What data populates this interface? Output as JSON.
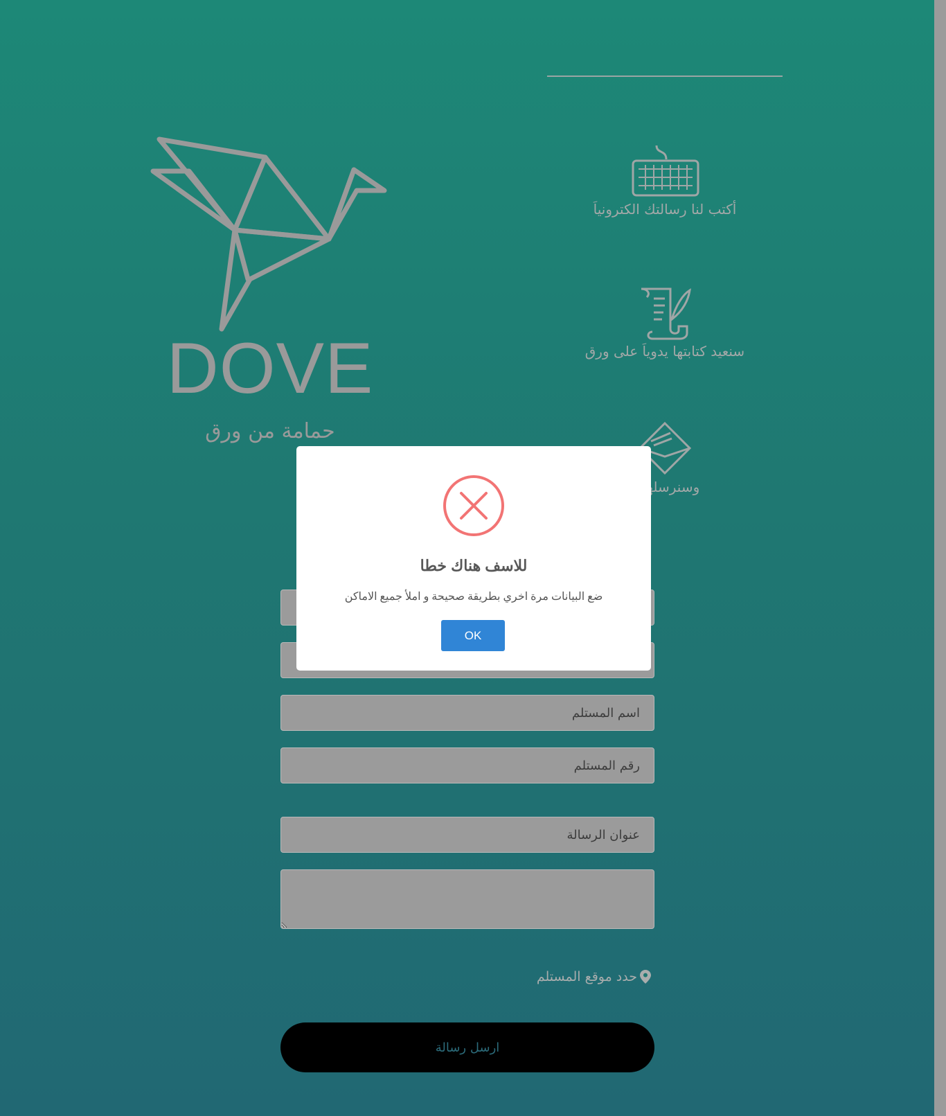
{
  "brand": {
    "name": "DOVE",
    "subtitle": "حمامة من ورق"
  },
  "features": [
    {
      "label": "أكتب لنا رسالتك الكترونياَ",
      "icon": "keyboard-icon"
    },
    {
      "label": "سنعيد كتابتها يدوياَ على ورق",
      "icon": "scroll-quill-icon"
    },
    {
      "label": "وسنرسلها لـ",
      "icon": "envelope-pen-icon"
    }
  ],
  "form": {
    "fields": [
      {
        "placeholder": ""
      },
      {
        "placeholder": ""
      },
      {
        "placeholder": "اسم المستلم"
      },
      {
        "placeholder": "رقم المستلم"
      },
      {
        "placeholder": "عنوان الرسالة"
      },
      {
        "placeholder": ""
      }
    ],
    "location_label": "حدد موقع المستلم",
    "location_icon": "map-pin-icon",
    "submit_label": "ارسل رسالة"
  },
  "modal": {
    "icon": "error-x-icon",
    "title": "للاسف هناك خطا",
    "text": "ضع البيانات مرة اخري بطريقة صحيحة و املأ جميع الاماكن",
    "ok_label": "OK"
  },
  "colors": {
    "background_top": "#1d8877",
    "background_bottom": "#216873",
    "muted_gray": "#9a9a9a",
    "ok_button": "#3085d6",
    "error_red": "#f27474",
    "submit_button": "#000000"
  }
}
